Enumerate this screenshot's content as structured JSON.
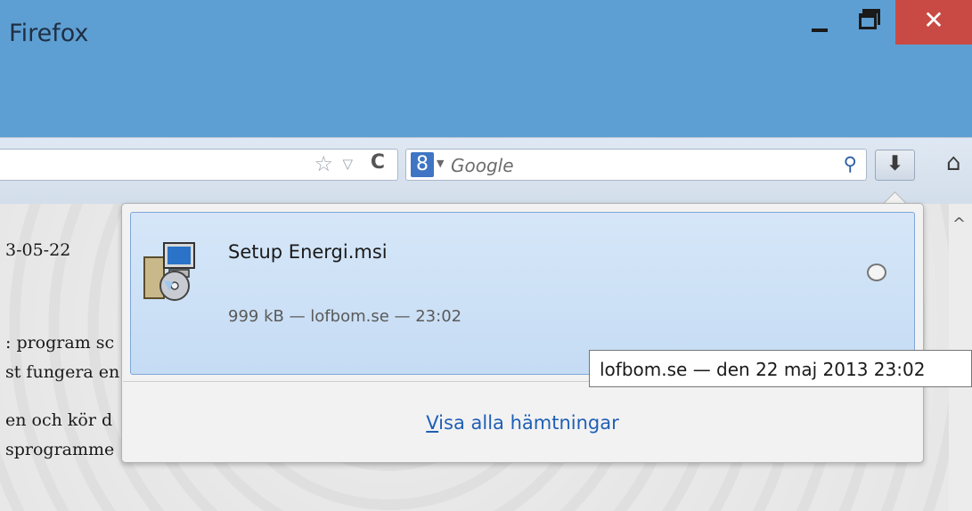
{
  "window": {
    "title": "Firefox",
    "close_glyph": "✕",
    "colors": {
      "titlebar": "#5e9fd3",
      "close": "#c94a44"
    }
  },
  "navbar": {
    "search_placeholder": "Google",
    "engine_glyph": "8",
    "icons": [
      "star-icon",
      "dropmarker-icon",
      "reload-icon",
      "search-engine-icon",
      "search-go-icon",
      "download-icon",
      "home-icon"
    ]
  },
  "page": {
    "lines": [
      "3-05-22",
      ": program sc",
      "st fungera en",
      "en och kör d",
      "sprogramme"
    ]
  },
  "downloads_panel": {
    "item": {
      "filename": "Setup Energi.msi",
      "status": "999 kB — lofbom.se — 23:02"
    },
    "show_all_label": "Visa alla hämtningar",
    "tooltip": "lofbom.se — den 22 maj 2013 23:02"
  }
}
